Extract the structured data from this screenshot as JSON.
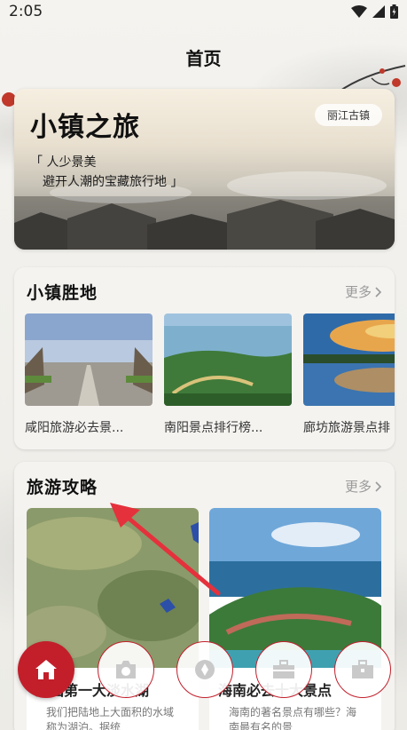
{
  "status": {
    "time": "2:05"
  },
  "header": {
    "title": "首页"
  },
  "hero": {
    "title": "小镇之旅",
    "tag": "丽江古镇",
    "quote_line1": "「 人少景美",
    "quote_line2": "避开人潮的宝藏旅行地 」"
  },
  "towns": {
    "title": "小镇胜地",
    "more": "更多",
    "items": [
      {
        "caption": "咸阳旅游必去景..."
      },
      {
        "caption": "南阳景点排行榜..."
      },
      {
        "caption": "廊坊旅游景点排"
      }
    ]
  },
  "guides": {
    "title": "旅游攻略",
    "more": "更多",
    "items": [
      {
        "caption": "全国第一大淡水湖",
        "desc": "我们把陆地上大面积的水域称为湖泊。据统"
      },
      {
        "caption": "海南必去十大景点",
        "desc": "海南的著名景点有哪些？海南最有名的景"
      }
    ]
  },
  "nav": {
    "items": [
      {
        "icon": "home-icon",
        "active": true
      },
      {
        "icon": "camera-icon",
        "active": false
      },
      {
        "icon": "aperture-icon",
        "active": false
      },
      {
        "icon": "briefcase-icon",
        "active": false
      },
      {
        "icon": "bag-icon",
        "active": false
      }
    ]
  },
  "colors": {
    "accent": "#c21f2b",
    "more_text": "#9a9a9a"
  }
}
